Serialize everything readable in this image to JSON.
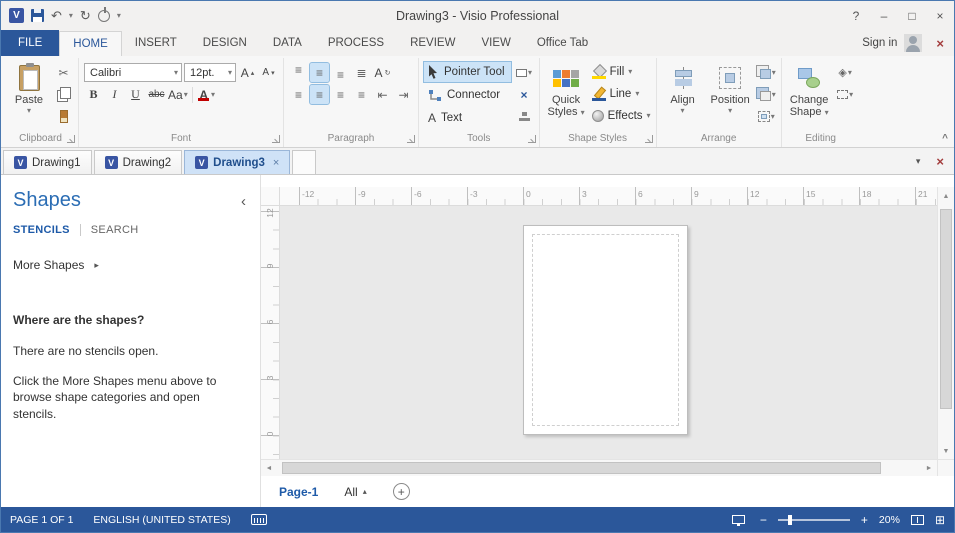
{
  "titlebar": {
    "title": "Drawing3 - Visio Professional"
  },
  "ribbon_tabs": {
    "file": "FILE",
    "home": "HOME",
    "insert": "INSERT",
    "design": "DESIGN",
    "data": "DATA",
    "process": "PROCESS",
    "review": "REVIEW",
    "view": "VIEW",
    "office_tab": "Office Tab",
    "sign_in": "Sign in"
  },
  "ribbon": {
    "clipboard": {
      "paste": "Paste",
      "label": "Clipboard"
    },
    "font": {
      "family": "Calibri",
      "size": "12pt.",
      "label": "Font"
    },
    "paragraph": {
      "label": "Paragraph"
    },
    "tools": {
      "pointer": "Pointer Tool",
      "connector": "Connector",
      "text": "Text",
      "label": "Tools"
    },
    "shape_styles": {
      "quick_line1": "Quick",
      "quick_line2": "Styles",
      "fill": "Fill",
      "line": "Line",
      "effects": "Effects",
      "label": "Shape Styles"
    },
    "arrange": {
      "align": "Align",
      "position": "Position",
      "label": "Arrange"
    },
    "editing": {
      "change_line1": "Change",
      "change_line2": "Shape",
      "label": "Editing"
    }
  },
  "doc_tabs": {
    "tab1": "Drawing1",
    "tab2": "Drawing2",
    "tab3": "Drawing3"
  },
  "shapes_panel": {
    "title": "Shapes",
    "tab_stencils": "STENCILS",
    "tab_search": "SEARCH",
    "more_shapes": "More Shapes",
    "empty_heading": "Where are the shapes?",
    "empty_line1": "There are no stencils open.",
    "empty_line2": "Click the More Shapes menu above to browse shape categories and open stencils."
  },
  "rulers": {
    "h": [
      "-12",
      "-9",
      "-6",
      "-3",
      "0",
      "3",
      "6",
      "9",
      "12",
      "15",
      "18",
      "21"
    ],
    "v": [
      "12",
      "9",
      "6",
      "3",
      "0"
    ]
  },
  "page_bar": {
    "active_page": "Page-1",
    "all": "All"
  },
  "status_bar": {
    "page_info": "PAGE 1 OF 1",
    "language": "ENGLISH (UNITED STATES)",
    "zoom_level": "20%"
  },
  "glyphs": {
    "logo": "V",
    "undo": "↶",
    "redo": "↻",
    "dropdown": "▾",
    "dropup": "▴",
    "help": "?",
    "minimize": "–",
    "maximize": "□",
    "close": "×",
    "cut": "✂",
    "bold": "B",
    "italic": "I",
    "underline": "U",
    "strike": "abc",
    "case": "Aa",
    "font_color": "A",
    "grow_font": "A",
    "shrink_font": "A",
    "align_lines": "≡",
    "bullets": "≣",
    "outdent": "⇤",
    "indent": "⇥",
    "text_tool": "A",
    "connection_x": "×",
    "collapse_ribbon": "^",
    "sidebar_collapse": "‹",
    "more_arrow": "▸",
    "up": "▲",
    "down": "▼",
    "left": "◄",
    "right": "►",
    "plus": "+",
    "minus": "−",
    "grid": "⊞",
    "layers": "◈"
  },
  "colors": {
    "accent": "#2B579A",
    "status_bg": "#2B579A",
    "active_doc_tab": "#CFE2F7",
    "canvas": "#E9E9E9"
  }
}
